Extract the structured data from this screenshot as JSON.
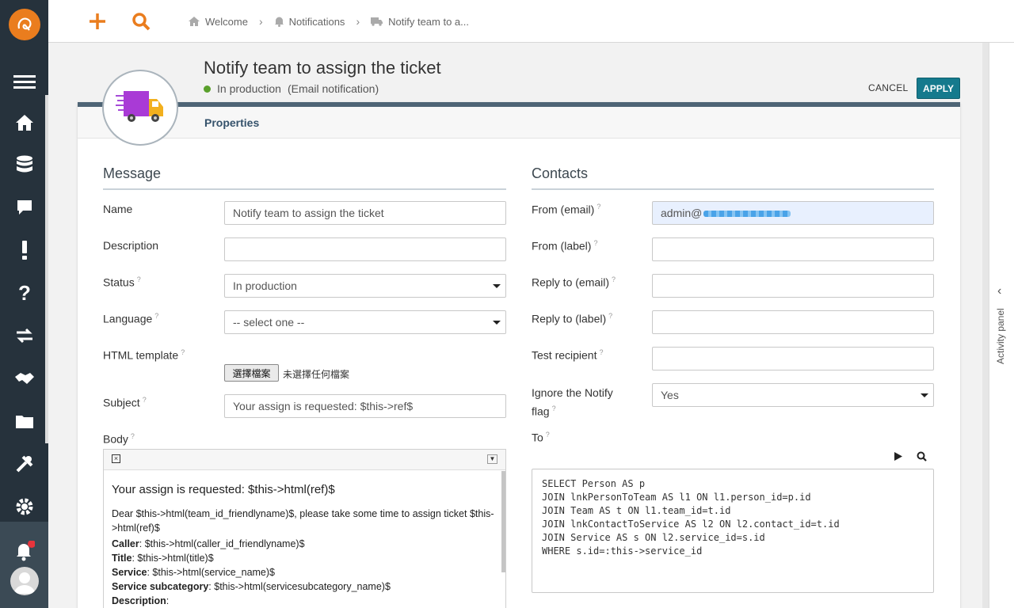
{
  "topbar": {
    "new_icon": "plus-icon",
    "search_icon": "search-icon"
  },
  "breadcrumb": {
    "items": [
      {
        "label": "Welcome",
        "icon": "home-icon"
      },
      {
        "label": "Notifications",
        "icon": "bell-icon"
      },
      {
        "label": "Notify team to a...",
        "icon": "truck-icon"
      }
    ]
  },
  "header": {
    "title": "Notify team to assign the ticket",
    "status": "In production",
    "type": "(Email notification)",
    "cancel_label": "CANCEL",
    "apply_label": "APPLY"
  },
  "tabs": {
    "properties": "Properties"
  },
  "message": {
    "section_title": "Message",
    "name_label": "Name",
    "name_value": "Notify team to assign the ticket",
    "description_label": "Description",
    "description_value": "",
    "status_label": "Status",
    "status_value": "In production",
    "language_label": "Language",
    "language_value": "-- select one --",
    "html_template_label": "HTML template",
    "file_button": "選擇檔案",
    "file_note": "未選擇任何檔案",
    "subject_label": "Subject",
    "subject_value": "Your assign is requested: $this->ref$",
    "body_label": "Body",
    "body": {
      "heading": "Your assign is requested: $this->html(ref)$",
      "intro": "Dear $this->html(team_id_friendlyname)$, please take some time to assign ticket $this->html(ref)$",
      "caller_k": "Caller",
      "caller_v": ": $this->html(caller_id_friendlyname)$",
      "title_k": "Title",
      "title_v": ": $this->html(title)$",
      "service_k": "Service",
      "service_v": ": $this->html(service_name)$",
      "subcat_k": "Service subcategory",
      "subcat_v": ": $this->html(servicesubcategory_name)$",
      "desc_k": "Description",
      "desc_v": ":"
    }
  },
  "contacts": {
    "section_title": "Contacts",
    "from_email_label": "From (email)",
    "from_email_value": "admin@",
    "from_label_label": "From (label)",
    "reply_email_label": "Reply to (email)",
    "reply_label_label": "Reply to (label)",
    "test_recipient_label": "Test recipient",
    "ignore_notify_label": "Ignore the Notify flag",
    "ignore_notify_value": "Yes",
    "to_label": "To",
    "to_query": "SELECT Person AS p\nJOIN lnkPersonToTeam AS l1 ON l1.person_id=p.id\nJOIN Team AS t ON l1.team_id=t.id\nJOIN lnkContactToService AS l2 ON l2.contact_id=t.id\nJOIN Service AS s ON l2.service_id=s.id\nWHERE s.id=:this->service_id"
  },
  "activity_panel": {
    "label": "Activity panel"
  },
  "colors": {
    "accent": "#157a8d",
    "sidebar": "#26323c",
    "logo": "#ea7d1e",
    "status_ok": "#5aa02c"
  }
}
